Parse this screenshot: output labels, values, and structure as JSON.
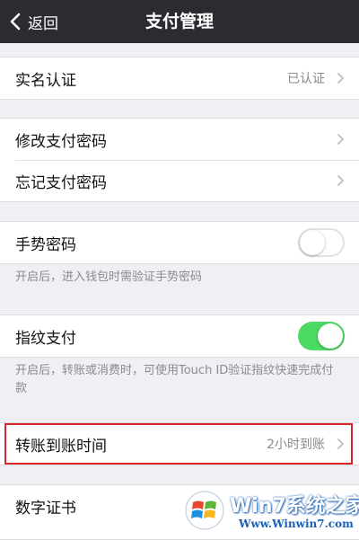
{
  "navbar": {
    "back_label": "返回",
    "title": "支付管理"
  },
  "groups": {
    "realname": {
      "label": "实名认证",
      "value": "已认证"
    },
    "change_password": {
      "label": "修改支付密码"
    },
    "forgot_password": {
      "label": "忘记支付密码"
    },
    "gesture": {
      "label": "手势密码",
      "enabled": false,
      "hint": "开启后，进入钱包时需验证手势密码"
    },
    "fingerprint": {
      "label": "指纹支付",
      "enabled": true,
      "hint": "开启后，转账或消费时，可使用Touch ID验证指纹快速完成付款"
    },
    "transfer_time": {
      "label": "转账到账时间",
      "value": "2小时到账"
    },
    "certificate": {
      "label": "数字证书"
    }
  },
  "watermark": {
    "title": "Win7系统之家",
    "url": "Www.Winwin7.com"
  },
  "colors": {
    "navbar": "#2b2c31",
    "background": "#efeff4",
    "toggle_on": "#4cd964",
    "highlight": "#d6262b"
  }
}
